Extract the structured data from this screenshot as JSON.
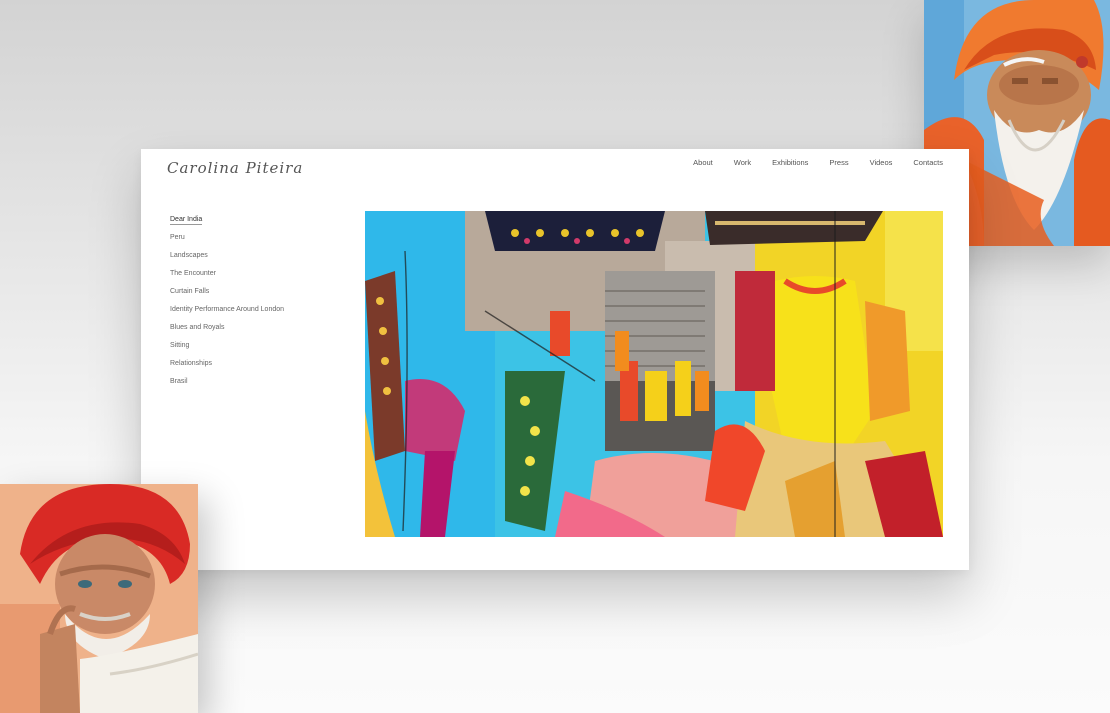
{
  "site": {
    "logo_text": "Carolina Piteira",
    "top_nav": [
      "About",
      "Work",
      "Exhibitions",
      "Press",
      "Videos",
      "Contacts"
    ],
    "side_nav": [
      {
        "label": "Dear India",
        "active": true
      },
      {
        "label": "Peru"
      },
      {
        "label": "Landscapes"
      },
      {
        "label": "The Encounter"
      },
      {
        "label": "Curtain Falls"
      },
      {
        "label": "Identity Performance Around London"
      },
      {
        "label": "Blues and Royals"
      },
      {
        "label": "Sitting"
      },
      {
        "label": "Relationships"
      },
      {
        "label": "Brasil"
      }
    ]
  },
  "colors": {
    "background": "#dcdcdc",
    "card": "#ffffff",
    "nav_text": "#555555"
  }
}
